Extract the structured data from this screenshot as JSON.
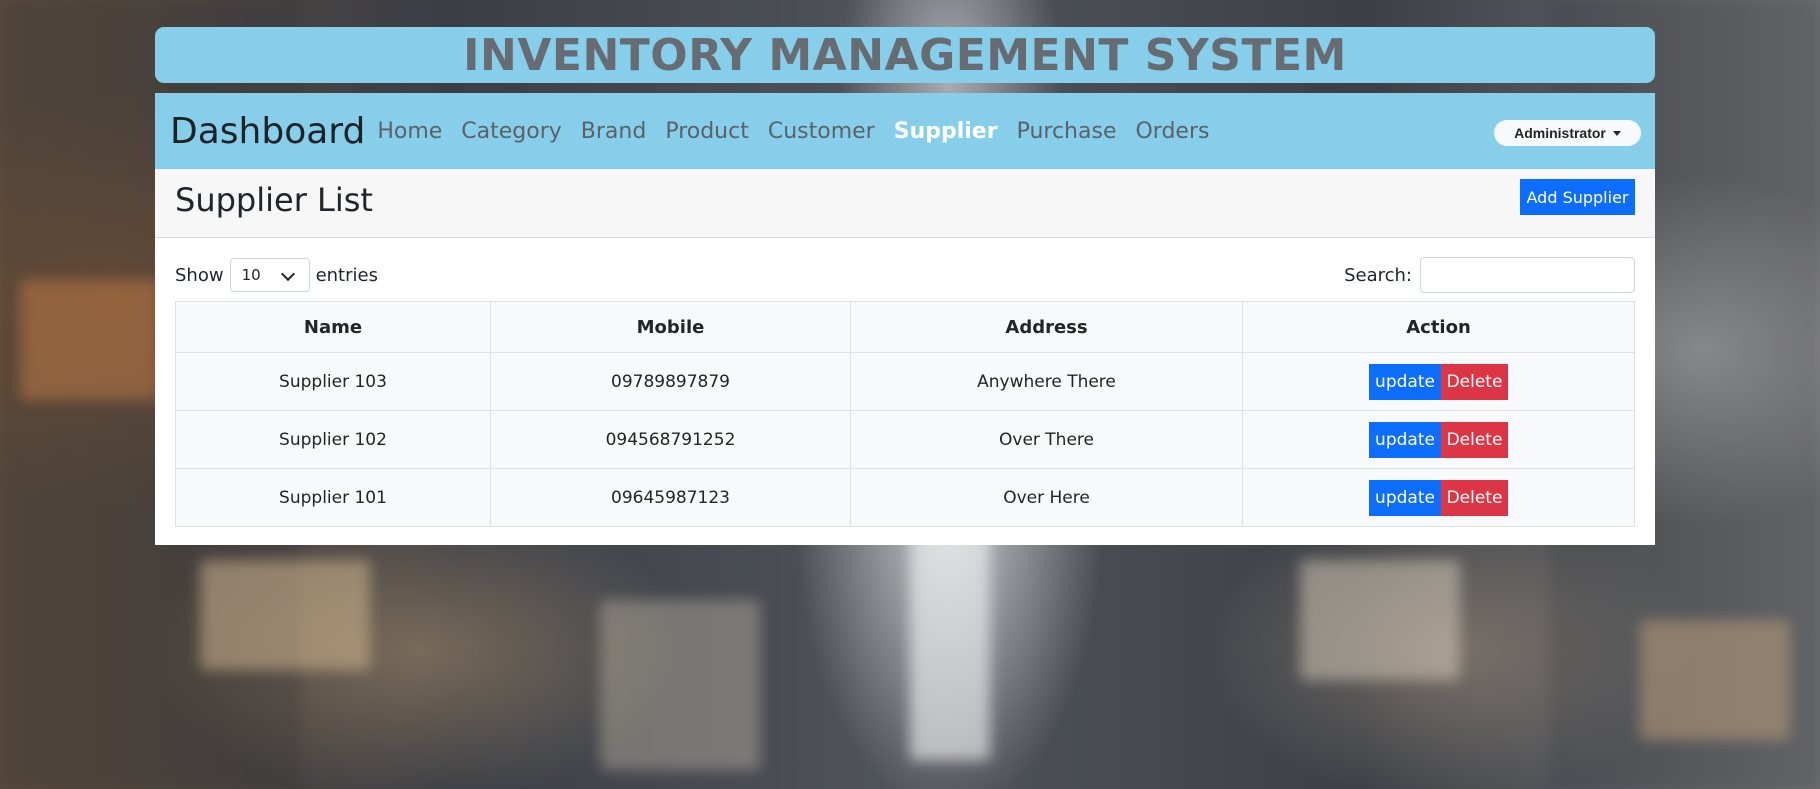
{
  "app": {
    "banner_title": "INVENTORY MANAGEMENT SYSTEM"
  },
  "navbar": {
    "brand": "Dashboard",
    "links": [
      "Home",
      "Category",
      "Brand",
      "Product",
      "Customer",
      "Supplier",
      "Purchase",
      "Orders"
    ],
    "active": "Supplier",
    "user_menu": "Administrator"
  },
  "page": {
    "title": "Supplier List",
    "add_button": "Add Supplier"
  },
  "table_controls": {
    "show_label": "Show",
    "entries_value": "10",
    "entries_label": "entries",
    "search_label": "Search:",
    "search_value": ""
  },
  "table": {
    "columns": [
      "Name",
      "Mobile",
      "Address",
      "Action"
    ],
    "rows": [
      {
        "name": "Supplier 103",
        "mobile": "09789897879",
        "address": "Anywhere There"
      },
      {
        "name": "Supplier 102",
        "mobile": "094568791252",
        "address": "Over There"
      },
      {
        "name": "Supplier 101",
        "mobile": "09645987123",
        "address": "Over Here"
      }
    ],
    "update_label": "update",
    "delete_label": "Delete"
  },
  "colors": {
    "header_bg": "#87ceeb",
    "primary": "#0d6efd",
    "danger": "#dc3545",
    "active_link": "#ffffff"
  },
  "icons": {
    "admin_caret": "caret-down-icon",
    "select_chevron": "chevron-down-icon"
  }
}
